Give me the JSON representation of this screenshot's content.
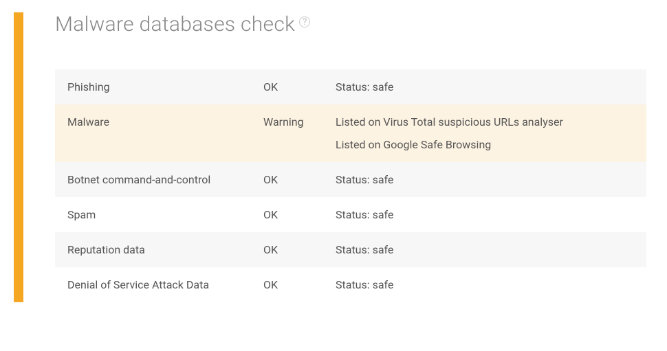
{
  "title": "Malware databases check",
  "checks": [
    {
      "category": "Phishing",
      "status": "OK",
      "details": [
        "Status: safe"
      ],
      "warning": false
    },
    {
      "category": "Malware",
      "status": "Warning",
      "details": [
        "Listed on Virus Total suspicious URLs analyser",
        "Listed on Google Safe Browsing"
      ],
      "warning": true
    },
    {
      "category": "Botnet command-and-control",
      "status": "OK",
      "details": [
        "Status: safe"
      ],
      "warning": false
    },
    {
      "category": "Spam",
      "status": "OK",
      "details": [
        "Status: safe"
      ],
      "warning": false
    },
    {
      "category": "Reputation data",
      "status": "OK",
      "details": [
        "Status: safe"
      ],
      "warning": false
    },
    {
      "category": "Denial of Service Attack Data",
      "status": "OK",
      "details": [
        "Status: safe"
      ],
      "warning": false
    }
  ]
}
